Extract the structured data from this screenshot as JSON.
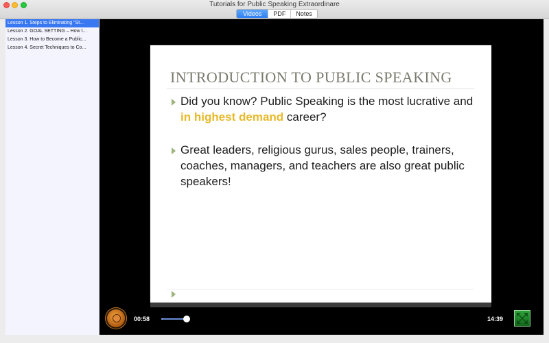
{
  "window": {
    "title": "Tutorials for Public Speaking Extraordinare"
  },
  "tabs": [
    {
      "label": "Videos",
      "active": true
    },
    {
      "label": "PDF",
      "active": false
    },
    {
      "label": "Notes",
      "active": false
    }
  ],
  "sidebar": {
    "lessons": [
      {
        "label": "Lesson 1. Steps to Eliminating \"St...",
        "selected": true
      },
      {
        "label": "Lesson 2. GOAL SETTING – How t...",
        "selected": false
      },
      {
        "label": "Lesson 3. How to Become a Public...",
        "selected": false
      },
      {
        "label": "Lesson 4. Secret Techniques to Co...",
        "selected": false
      }
    ]
  },
  "slide": {
    "title": "INTRODUCTION TO PUBLIC SPEAKING",
    "bullet1_prefix": "Did you know? Public Speaking is the most lucrative and ",
    "bullet1_highlight": "in highest demand",
    "bullet1_suffix": " career?",
    "bullet2": "Great leaders, religious gurus, sales people, trainers, coaches, managers, and teachers are also great public speakers!"
  },
  "player": {
    "elapsed": "00:58",
    "total": "14:39",
    "progress": 0.066,
    "colors": {
      "accent": "#3a78f2",
      "highlight": "#e8b92a",
      "play": "#d9822b",
      "fullscreen": "#1f8a2a"
    }
  },
  "icons": {
    "play": "play-icon",
    "fullscreen": "fullscreen-icon"
  }
}
